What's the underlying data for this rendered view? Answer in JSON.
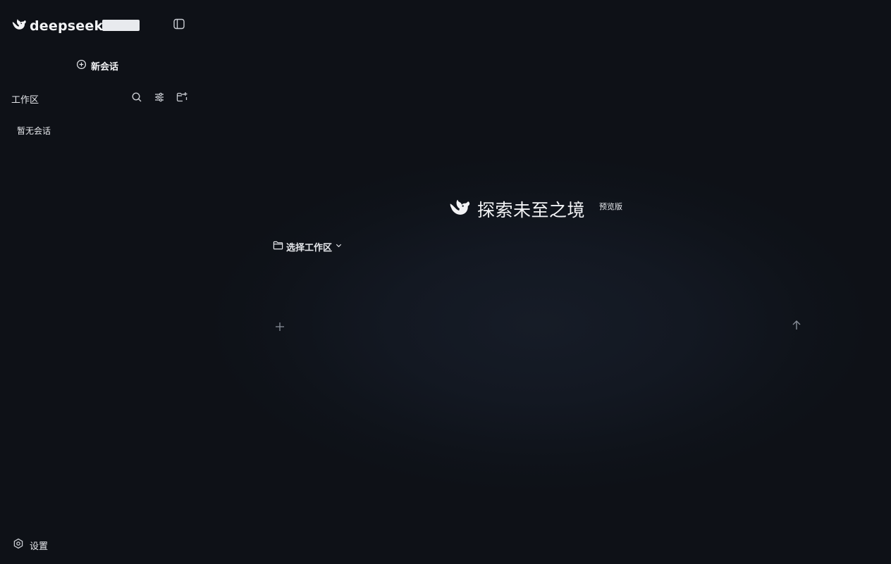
{
  "brand": {
    "name": "deepseek",
    "logo_icon": "whale-icon"
  },
  "sidebar": {
    "new_chat_label": "新会话",
    "workspace_title": "工作区",
    "empty_label": "暂无会话",
    "settings_label": "设置",
    "icons": [
      "sidebar-toggle-icon",
      "search-icon",
      "filter-icon",
      "new-folder-icon",
      "gear-icon"
    ]
  },
  "main": {
    "hero_title": "探索未至之境",
    "hero_badge": "预览版",
    "workspace_select_label": "选择工作区",
    "input_placeholder": "",
    "icons": [
      "folder-icon",
      "chevron-down-icon",
      "plus-icon",
      "arrow-up-icon"
    ]
  },
  "colors": {
    "background": "#0e1117",
    "panel_glow": "#161c27",
    "text": "#e6e8ec",
    "muted_icon": "#8a909a"
  }
}
